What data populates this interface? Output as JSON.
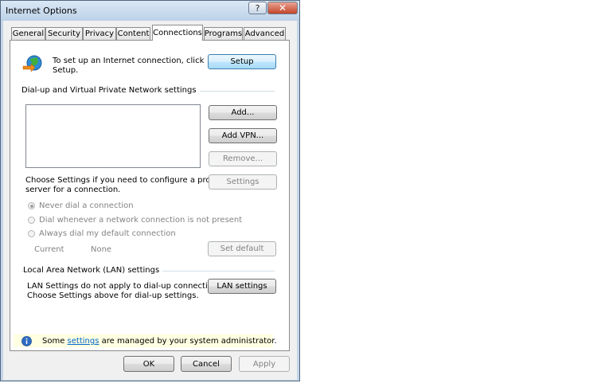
{
  "window": {
    "title": "Internet Options"
  },
  "title_buttons": {
    "help": "?",
    "close": "✕"
  },
  "tabs": [
    {
      "label": "General"
    },
    {
      "label": "Security"
    },
    {
      "label": "Privacy"
    },
    {
      "label": "Content"
    },
    {
      "label": "Connections",
      "active": true
    },
    {
      "label": "Programs"
    },
    {
      "label": "Advanced"
    }
  ],
  "setup": {
    "text_line1": "To set up an Internet connection, click",
    "text_line2": "Setup.",
    "button": "Setup"
  },
  "dialup": {
    "group_label": "Dial-up and Virtual Private Network settings",
    "add_button": "Add...",
    "add_vpn_button": "Add VPN...",
    "remove_button": "Remove...",
    "settings_text_line1": "Choose Settings if you need to configure a proxy",
    "settings_text_line2": "server for a connection.",
    "settings_button": "Settings",
    "radios": [
      {
        "label": "Never dial a connection",
        "selected": true
      },
      {
        "label": "Dial whenever a network connection is not present",
        "selected": false
      },
      {
        "label": "Always dial my default connection",
        "selected": false
      }
    ],
    "current_label": "Current",
    "current_value": "None",
    "set_default_button": "Set default"
  },
  "lan": {
    "group_label": "Local Area Network (LAN) settings",
    "text_line1": "LAN Settings do not apply to dial-up connections.",
    "text_line2": "Choose Settings above for dial-up settings.",
    "button": "LAN settings"
  },
  "info_bar": {
    "prefix": "Some ",
    "link": "settings",
    "suffix": " are managed by your system administrator."
  },
  "dialog_buttons": {
    "ok": "OK",
    "cancel": "Cancel",
    "apply": "Apply"
  }
}
